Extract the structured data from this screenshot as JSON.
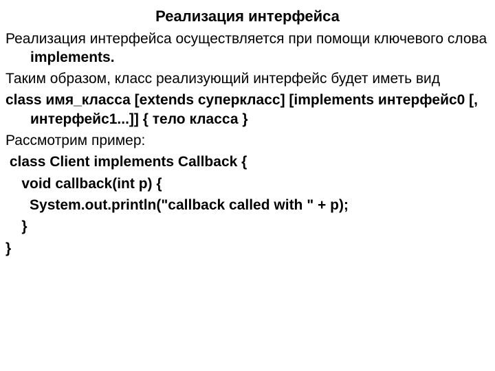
{
  "title": "Реализация интерфейса",
  "p1_a": "Реализация интерфейса осуществляется при помощи ключевого слова ",
  "p1_b": "implements.",
  "p2": "Таким образом, класс реализующий интерфейс будет иметь вид",
  "syntax": "class имя_класса [extends суперкласс] [implements интерфейс0 [, интерфейс1...]] { тело класса }",
  "p3": "Рассмотрим пример:",
  "code": {
    "l1": " class Client implements Callback {",
    "l2": "    void callback(int p) {",
    "l3": "      System.out.println(\"callback called with \" + p);",
    "l4": "    }",
    "l5": "}"
  }
}
